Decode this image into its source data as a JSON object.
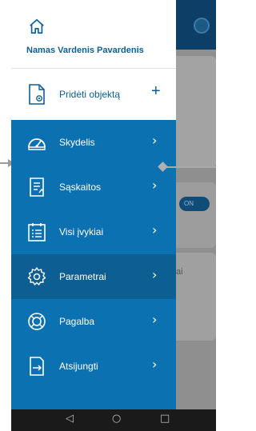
{
  "drawer": {
    "user_name": "Namas Vardenis Pavardenis",
    "add_object": {
      "label": "Pridėti objektą",
      "plus": "+"
    },
    "items": [
      {
        "label": "Skydelis",
        "icon": "dashboard-gauge-icon"
      },
      {
        "label": "Sąskaitos",
        "icon": "invoice-icon"
      },
      {
        "label": "Visi įvykiai",
        "icon": "events-list-icon"
      },
      {
        "label": "Parametrai",
        "icon": "settings-gear-icon",
        "active": true
      },
      {
        "label": "Pagalba",
        "icon": "help-lifebuoy-icon"
      },
      {
        "label": "Atsijungti",
        "icon": "logout-icon"
      }
    ],
    "chevron": "›"
  },
  "background": {
    "switch_label": "ON",
    "partial_text": "ai"
  },
  "navbar": {
    "back": "◁",
    "home": "○",
    "recents": "□"
  },
  "colors": {
    "drawer": "#0b71b0",
    "active": "#0d5f93",
    "accent_text": "#0b5f96"
  }
}
